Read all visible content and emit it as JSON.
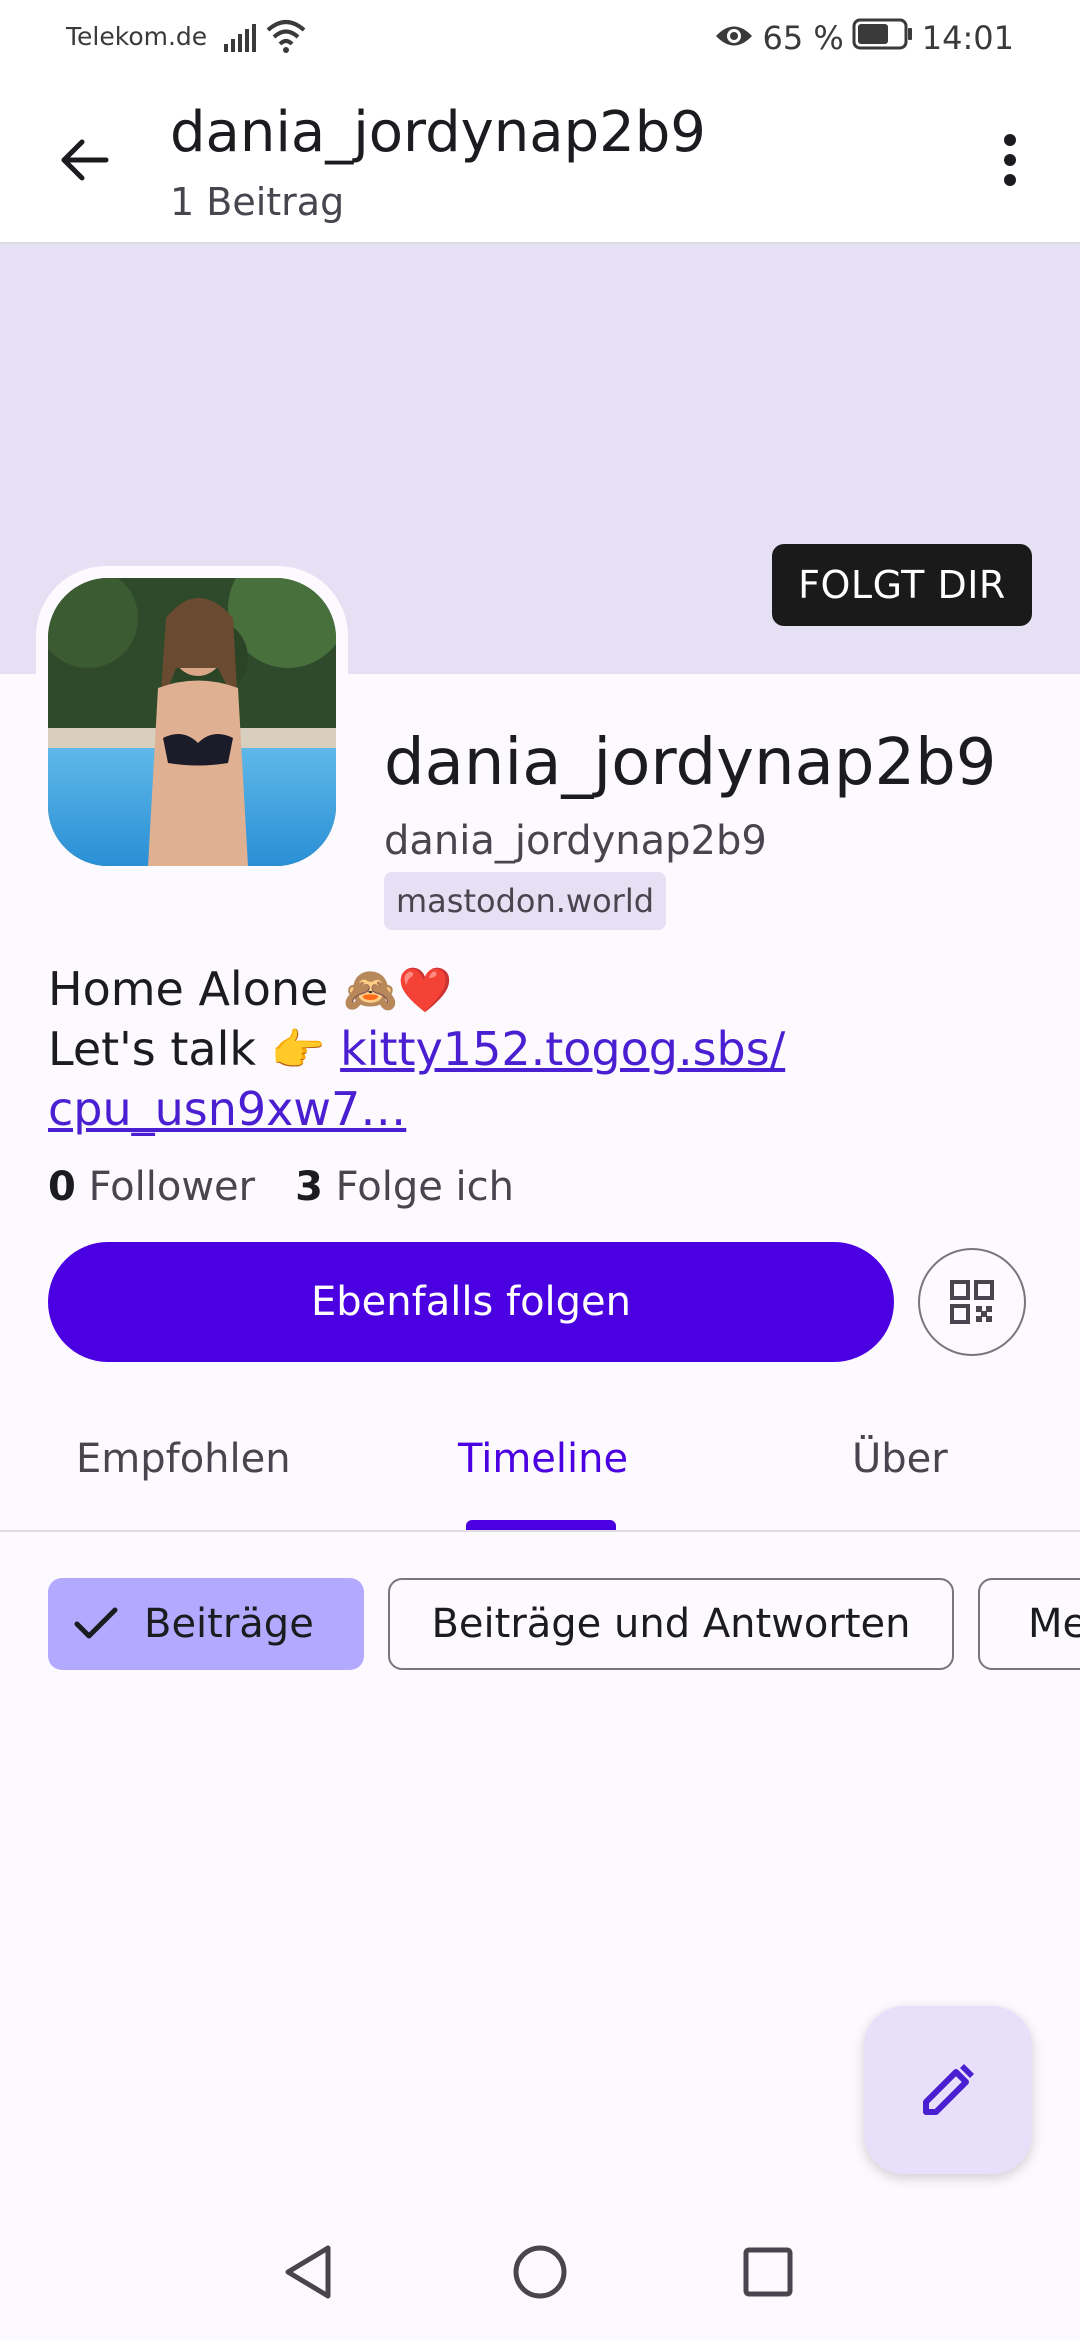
{
  "status_bar": {
    "carrier": "Telekom.de",
    "battery_percent": "65 %",
    "time": "14:01"
  },
  "app_bar": {
    "title": "dania_jordynap2b9",
    "subtitle": "1 Beitrag"
  },
  "profile": {
    "follows_you_badge": "FOLGT DIR",
    "display_name": "dania_jordynap2b9",
    "username": "dania_jordynap2b9",
    "domain": "mastodon.world",
    "bio_line1": "Home Alone",
    "bio_line1_emoji": "🙈❤️",
    "bio_line2_prefix": "Let's talk",
    "bio_line2_emoji": "👉",
    "bio_link_part1": "kitty152.togog.sbs/",
    "bio_link_part2": "cpu_usn9xw7…",
    "followers_count": "0",
    "followers_label": "Follower",
    "following_count": "3",
    "following_label": "Folge ich",
    "follow_button": "Ebenfalls folgen"
  },
  "tabs": [
    {
      "label": "Empfohlen",
      "active": false
    },
    {
      "label": "Timeline",
      "active": true
    },
    {
      "label": "Über",
      "active": false
    }
  ],
  "filter_chips": [
    {
      "label": "Beiträge",
      "selected": true
    },
    {
      "label": "Beiträge und Antworten",
      "selected": false
    },
    {
      "label": "Me",
      "selected": false
    }
  ],
  "colors": {
    "primary": "#4a00e0",
    "banner": "#e5e0f3",
    "chip_selected": "#b3aaff",
    "fab": "#e8e0fb"
  }
}
